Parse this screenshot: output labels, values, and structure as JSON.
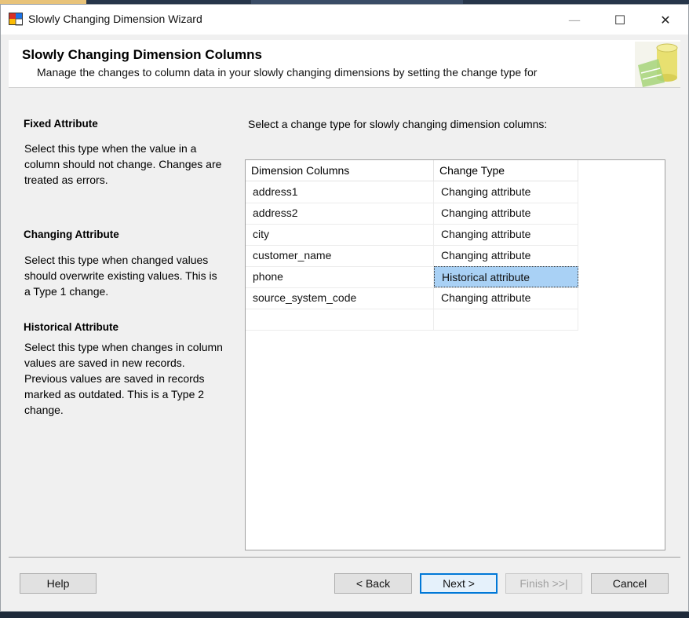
{
  "window": {
    "title": "Slowly Changing Dimension Wizard",
    "controls": {
      "minimize": "—",
      "maximize": "☐",
      "close": "✕"
    }
  },
  "header": {
    "title": "Slowly Changing Dimension Columns",
    "subtitle": "Manage the changes to column data in your slowly changing dimensions by setting the change type for"
  },
  "sidebar": {
    "fixed": {
      "title": "Fixed Attribute",
      "description": "Select this type when the value in a column should not change. Changes are treated as errors."
    },
    "changing": {
      "title": "Changing Attribute",
      "description": "Select this type when changed values should overwrite existing values. This is a Type 1 change."
    },
    "historical": {
      "title": "Historical Attribute",
      "description": "Select this type when changes in column values are saved in new records. Previous values are saved in records marked as outdated. This is a Type 2 change."
    }
  },
  "main": {
    "instruction": "Select a change type for slowly changing dimension columns:",
    "columns": [
      "Dimension Columns",
      "Change Type"
    ],
    "rows": [
      {
        "column": "address1",
        "type": "Changing attribute",
        "selected": false
      },
      {
        "column": "address2",
        "type": "Changing attribute",
        "selected": false
      },
      {
        "column": "city",
        "type": "Changing attribute",
        "selected": false
      },
      {
        "column": "customer_name",
        "type": "Changing attribute",
        "selected": false
      },
      {
        "column": "phone",
        "type": "Historical attribute",
        "selected": true
      },
      {
        "column": "source_system_code",
        "type": "Changing attribute",
        "selected": false
      },
      {
        "column": "",
        "type": "",
        "selected": false
      }
    ]
  },
  "buttons": {
    "help": "Help",
    "back": "< Back",
    "next": "Next >",
    "finish": "Finish >>|",
    "cancel": "Cancel"
  },
  "colors": {
    "selection": "#a9d1f5",
    "primary_border": "#0078d7"
  }
}
